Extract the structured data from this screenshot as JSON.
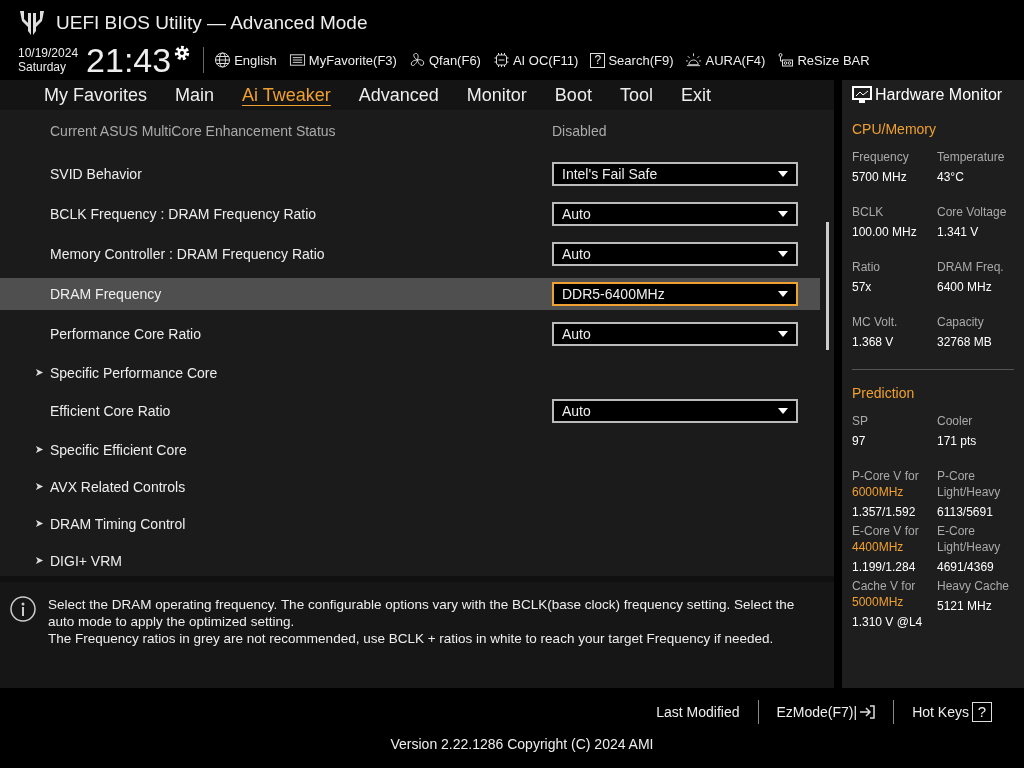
{
  "window": {
    "title": "UEFI BIOS Utility — Advanced Mode"
  },
  "header": {
    "date": "10/19/2024",
    "day": "Saturday",
    "time": "21:43",
    "tools": [
      {
        "kind": "globe",
        "label": "English"
      },
      {
        "kind": "favorite",
        "label": "MyFavorite(F3)"
      },
      {
        "kind": "fan",
        "label": "Qfan(F6)"
      },
      {
        "kind": "chip",
        "label": "AI OC(F11)"
      },
      {
        "kind": "search",
        "label": "Search(F9)",
        "glyph": "?"
      },
      {
        "kind": "aura",
        "label": "AURA(F4)"
      },
      {
        "kind": "resize",
        "label": "ReSize BAR"
      }
    ]
  },
  "tabs": [
    {
      "label": "My Favorites",
      "selected": false
    },
    {
      "label": "Main",
      "selected": false
    },
    {
      "label": "Ai Tweaker",
      "selected": true
    },
    {
      "label": "Advanced",
      "selected": false
    },
    {
      "label": "Monitor",
      "selected": false
    },
    {
      "label": "Boot",
      "selected": false
    },
    {
      "label": "Tool",
      "selected": false
    },
    {
      "label": "Exit",
      "selected": false
    }
  ],
  "settings": [
    {
      "kind": "status",
      "label": "Current ASUS MultiCore Enhancement Status",
      "value": "Disabled",
      "selected": false
    },
    {
      "kind": "dropdown",
      "label": "SVID Behavior",
      "value": "Intel's Fail Safe",
      "selected": false
    },
    {
      "kind": "dropdown",
      "label": "BCLK Frequency : DRAM Frequency Ratio",
      "value": "Auto",
      "selected": false
    },
    {
      "kind": "dropdown",
      "label": "Memory Controller : DRAM Frequency Ratio",
      "value": "Auto",
      "selected": false
    },
    {
      "kind": "dropdown",
      "label": "DRAM Frequency",
      "value": "DDR5-6400MHz",
      "selected": true
    },
    {
      "kind": "dropdown",
      "label": "Performance Core Ratio",
      "value": "Auto",
      "selected": false
    },
    {
      "kind": "submenu",
      "label": "Specific Performance Core",
      "selected": false
    },
    {
      "kind": "dropdown",
      "label": "Efficient Core Ratio",
      "value": "Auto",
      "selected": false
    },
    {
      "kind": "submenu",
      "label": "Specific Efficient Core",
      "selected": false
    },
    {
      "kind": "submenu",
      "label": "AVX Related Controls",
      "selected": false
    },
    {
      "kind": "submenu",
      "label": "DRAM Timing Control",
      "selected": false
    },
    {
      "kind": "submenu",
      "label": "DIGI+ VRM",
      "selected": false
    }
  ],
  "help": {
    "lines": [
      "Select the DRAM operating frequency. The configurable options vary with the BCLK(base clock) frequency setting. Select the auto mode to apply the optimized setting.",
      "The Frequency ratios in grey are not recommended, use BCLK + ratios in white to reach your target Frequency if needed."
    ]
  },
  "hardware_monitor": {
    "title": "Hardware Monitor",
    "sections": [
      {
        "title": "CPU/Memory",
        "items": [
          {
            "label": "Frequency",
            "value": "5700 MHz"
          },
          {
            "label": "Temperature",
            "value": "43°C"
          },
          {
            "label": "BCLK",
            "value": "100.00 MHz"
          },
          {
            "label": "Core Voltage",
            "value": "1.341 V"
          },
          {
            "label": "Ratio",
            "value": "57x"
          },
          {
            "label": "DRAM Freq.",
            "value": "6400 MHz"
          },
          {
            "label": "MC Volt.",
            "value": "1.368 V"
          },
          {
            "label": "Capacity",
            "value": "32768 MB"
          }
        ]
      },
      {
        "title": "Prediction",
        "items": [
          {
            "label": "SP",
            "value": "97"
          },
          {
            "label": "Cooler",
            "value": "171 pts"
          },
          {
            "label": "P-Core V for",
            "highlight": "6000MHz",
            "value": "1.357/1.592"
          },
          {
            "label": "P-Core Light/Heavy",
            "value": "6113/5691"
          },
          {
            "label": "E-Core V for",
            "highlight": "4400MHz",
            "value": "1.199/1.284"
          },
          {
            "label": "E-Core Light/Heavy",
            "value": "4691/4369"
          },
          {
            "label": "Cache V for",
            "highlight": "5000MHz",
            "value": "1.310 V @L4"
          },
          {
            "label": "Heavy Cache",
            "value": "5121 MHz"
          }
        ]
      }
    ]
  },
  "footer": {
    "last_modified": "Last Modified",
    "ez_mode": "EzMode(F7)|",
    "hot_keys": "Hot Keys",
    "hot_keys_glyph": "?",
    "version": "Version 2.22.1286 Copyright (C) 2024 AMI"
  }
}
